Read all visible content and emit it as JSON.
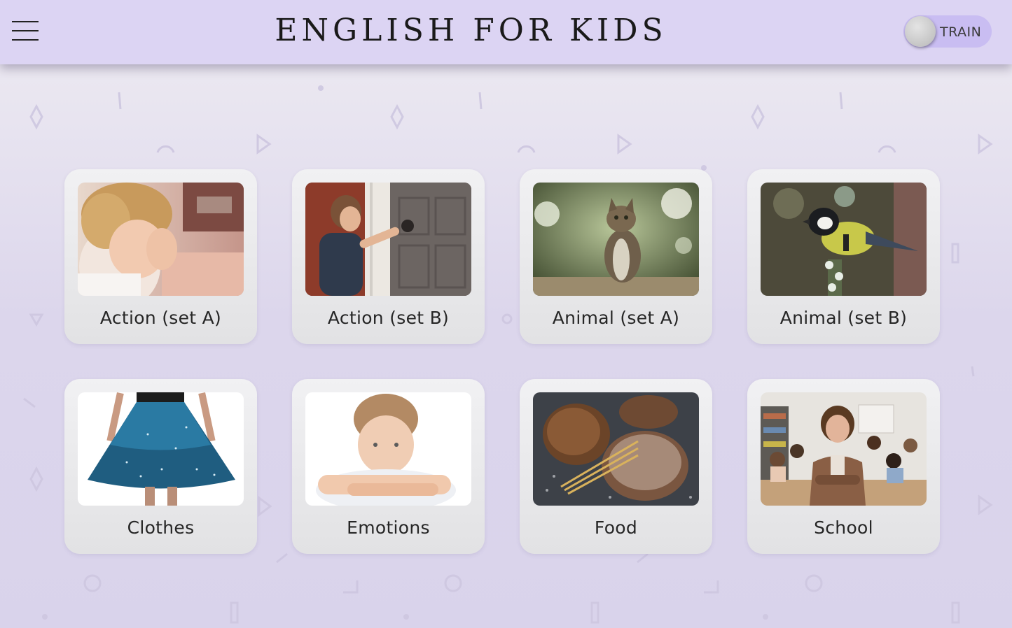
{
  "header": {
    "title": "ENGLISH FOR KIDS",
    "menu_icon": "hamburger-menu-icon",
    "mode_toggle": {
      "label": "TRAIN",
      "checked": false
    }
  },
  "categories": [
    {
      "label": "Action (set A)",
      "image": "crying-child-photo"
    },
    {
      "label": "Action (set B)",
      "image": "boy-opening-door-photo"
    },
    {
      "label": "Animal (set A)",
      "image": "cat-photo"
    },
    {
      "label": "Animal (set B)",
      "image": "tit-bird-photo"
    },
    {
      "label": "Clothes",
      "image": "blue-skirt-photo"
    },
    {
      "label": "Emotions",
      "image": "sad-boy-photo"
    },
    {
      "label": "Food",
      "image": "bread-loaves-photo"
    },
    {
      "label": "School",
      "image": "teacher-classroom-photo"
    }
  ],
  "colors": {
    "header_bg": "#dcd4f3",
    "page_bg": "#dcd6ec",
    "toggle_bg": "#c9bdf2",
    "card_bg": "#ebebed"
  }
}
